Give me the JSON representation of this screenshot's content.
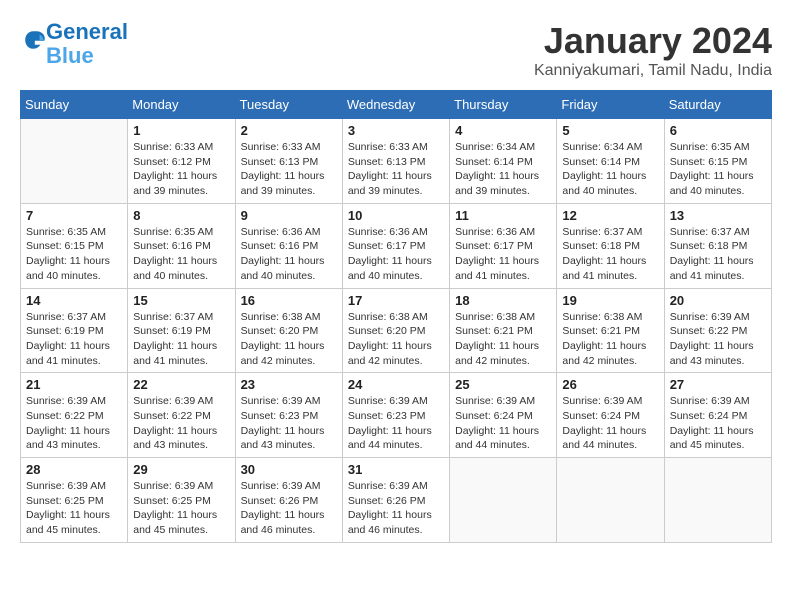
{
  "header": {
    "logo_line1": "General",
    "logo_line2": "Blue",
    "month": "January 2024",
    "location": "Kanniyakumari, Tamil Nadu, India"
  },
  "days_of_week": [
    "Sunday",
    "Monday",
    "Tuesday",
    "Wednesday",
    "Thursday",
    "Friday",
    "Saturday"
  ],
  "weeks": [
    [
      {
        "day": "",
        "sunrise": "",
        "sunset": "",
        "daylight": ""
      },
      {
        "day": "1",
        "sunrise": "Sunrise: 6:33 AM",
        "sunset": "Sunset: 6:12 PM",
        "daylight": "Daylight: 11 hours and 39 minutes."
      },
      {
        "day": "2",
        "sunrise": "Sunrise: 6:33 AM",
        "sunset": "Sunset: 6:13 PM",
        "daylight": "Daylight: 11 hours and 39 minutes."
      },
      {
        "day": "3",
        "sunrise": "Sunrise: 6:33 AM",
        "sunset": "Sunset: 6:13 PM",
        "daylight": "Daylight: 11 hours and 39 minutes."
      },
      {
        "day": "4",
        "sunrise": "Sunrise: 6:34 AM",
        "sunset": "Sunset: 6:14 PM",
        "daylight": "Daylight: 11 hours and 39 minutes."
      },
      {
        "day": "5",
        "sunrise": "Sunrise: 6:34 AM",
        "sunset": "Sunset: 6:14 PM",
        "daylight": "Daylight: 11 hours and 40 minutes."
      },
      {
        "day": "6",
        "sunrise": "Sunrise: 6:35 AM",
        "sunset": "Sunset: 6:15 PM",
        "daylight": "Daylight: 11 hours and 40 minutes."
      }
    ],
    [
      {
        "day": "7",
        "sunrise": "Sunrise: 6:35 AM",
        "sunset": "Sunset: 6:15 PM",
        "daylight": "Daylight: 11 hours and 40 minutes."
      },
      {
        "day": "8",
        "sunrise": "Sunrise: 6:35 AM",
        "sunset": "Sunset: 6:16 PM",
        "daylight": "Daylight: 11 hours and 40 minutes."
      },
      {
        "day": "9",
        "sunrise": "Sunrise: 6:36 AM",
        "sunset": "Sunset: 6:16 PM",
        "daylight": "Daylight: 11 hours and 40 minutes."
      },
      {
        "day": "10",
        "sunrise": "Sunrise: 6:36 AM",
        "sunset": "Sunset: 6:17 PM",
        "daylight": "Daylight: 11 hours and 40 minutes."
      },
      {
        "day": "11",
        "sunrise": "Sunrise: 6:36 AM",
        "sunset": "Sunset: 6:17 PM",
        "daylight": "Daylight: 11 hours and 41 minutes."
      },
      {
        "day": "12",
        "sunrise": "Sunrise: 6:37 AM",
        "sunset": "Sunset: 6:18 PM",
        "daylight": "Daylight: 11 hours and 41 minutes."
      },
      {
        "day": "13",
        "sunrise": "Sunrise: 6:37 AM",
        "sunset": "Sunset: 6:18 PM",
        "daylight": "Daylight: 11 hours and 41 minutes."
      }
    ],
    [
      {
        "day": "14",
        "sunrise": "Sunrise: 6:37 AM",
        "sunset": "Sunset: 6:19 PM",
        "daylight": "Daylight: 11 hours and 41 minutes."
      },
      {
        "day": "15",
        "sunrise": "Sunrise: 6:37 AM",
        "sunset": "Sunset: 6:19 PM",
        "daylight": "Daylight: 11 hours and 41 minutes."
      },
      {
        "day": "16",
        "sunrise": "Sunrise: 6:38 AM",
        "sunset": "Sunset: 6:20 PM",
        "daylight": "Daylight: 11 hours and 42 minutes."
      },
      {
        "day": "17",
        "sunrise": "Sunrise: 6:38 AM",
        "sunset": "Sunset: 6:20 PM",
        "daylight": "Daylight: 11 hours and 42 minutes."
      },
      {
        "day": "18",
        "sunrise": "Sunrise: 6:38 AM",
        "sunset": "Sunset: 6:21 PM",
        "daylight": "Daylight: 11 hours and 42 minutes."
      },
      {
        "day": "19",
        "sunrise": "Sunrise: 6:38 AM",
        "sunset": "Sunset: 6:21 PM",
        "daylight": "Daylight: 11 hours and 42 minutes."
      },
      {
        "day": "20",
        "sunrise": "Sunrise: 6:39 AM",
        "sunset": "Sunset: 6:22 PM",
        "daylight": "Daylight: 11 hours and 43 minutes."
      }
    ],
    [
      {
        "day": "21",
        "sunrise": "Sunrise: 6:39 AM",
        "sunset": "Sunset: 6:22 PM",
        "daylight": "Daylight: 11 hours and 43 minutes."
      },
      {
        "day": "22",
        "sunrise": "Sunrise: 6:39 AM",
        "sunset": "Sunset: 6:22 PM",
        "daylight": "Daylight: 11 hours and 43 minutes."
      },
      {
        "day": "23",
        "sunrise": "Sunrise: 6:39 AM",
        "sunset": "Sunset: 6:23 PM",
        "daylight": "Daylight: 11 hours and 43 minutes."
      },
      {
        "day": "24",
        "sunrise": "Sunrise: 6:39 AM",
        "sunset": "Sunset: 6:23 PM",
        "daylight": "Daylight: 11 hours and 44 minutes."
      },
      {
        "day": "25",
        "sunrise": "Sunrise: 6:39 AM",
        "sunset": "Sunset: 6:24 PM",
        "daylight": "Daylight: 11 hours and 44 minutes."
      },
      {
        "day": "26",
        "sunrise": "Sunrise: 6:39 AM",
        "sunset": "Sunset: 6:24 PM",
        "daylight": "Daylight: 11 hours and 44 minutes."
      },
      {
        "day": "27",
        "sunrise": "Sunrise: 6:39 AM",
        "sunset": "Sunset: 6:24 PM",
        "daylight": "Daylight: 11 hours and 45 minutes."
      }
    ],
    [
      {
        "day": "28",
        "sunrise": "Sunrise: 6:39 AM",
        "sunset": "Sunset: 6:25 PM",
        "daylight": "Daylight: 11 hours and 45 minutes."
      },
      {
        "day": "29",
        "sunrise": "Sunrise: 6:39 AM",
        "sunset": "Sunset: 6:25 PM",
        "daylight": "Daylight: 11 hours and 45 minutes."
      },
      {
        "day": "30",
        "sunrise": "Sunrise: 6:39 AM",
        "sunset": "Sunset: 6:26 PM",
        "daylight": "Daylight: 11 hours and 46 minutes."
      },
      {
        "day": "31",
        "sunrise": "Sunrise: 6:39 AM",
        "sunset": "Sunset: 6:26 PM",
        "daylight": "Daylight: 11 hours and 46 minutes."
      },
      {
        "day": "",
        "sunrise": "",
        "sunset": "",
        "daylight": ""
      },
      {
        "day": "",
        "sunrise": "",
        "sunset": "",
        "daylight": ""
      },
      {
        "day": "",
        "sunrise": "",
        "sunset": "",
        "daylight": ""
      }
    ]
  ]
}
